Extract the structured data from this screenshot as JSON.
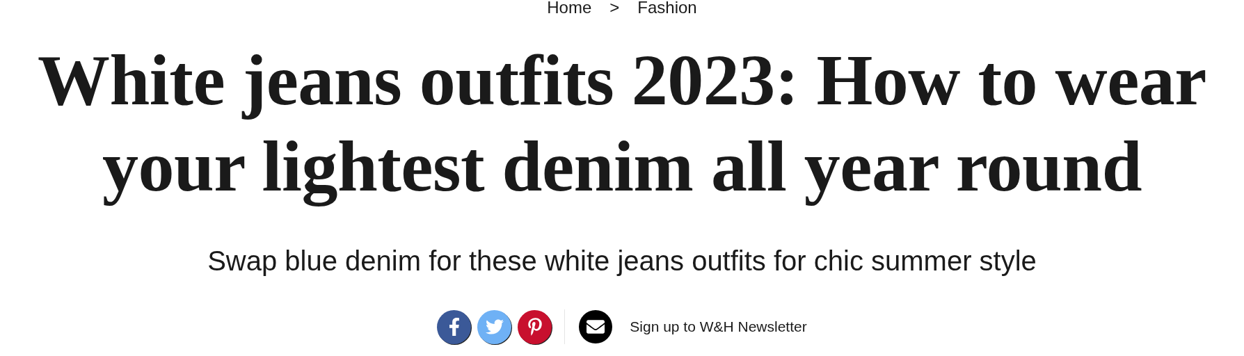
{
  "breadcrumb": {
    "items": [
      "Home",
      "Fashion"
    ],
    "separator": ">"
  },
  "title": "White jeans outfits 2023: How to wear your lightest denim all year round",
  "standfirst": "Swap blue denim for these white jeans outfits for chic summer style",
  "share_buttons": [
    {
      "kind": "facebook",
      "color": "#3b5998"
    },
    {
      "kind": "twitter",
      "color": "#6fb1f5"
    },
    {
      "kind": "pinterest",
      "color": "#c8102e"
    }
  ],
  "newsletter": {
    "label": "Sign up to W&H Newsletter"
  }
}
